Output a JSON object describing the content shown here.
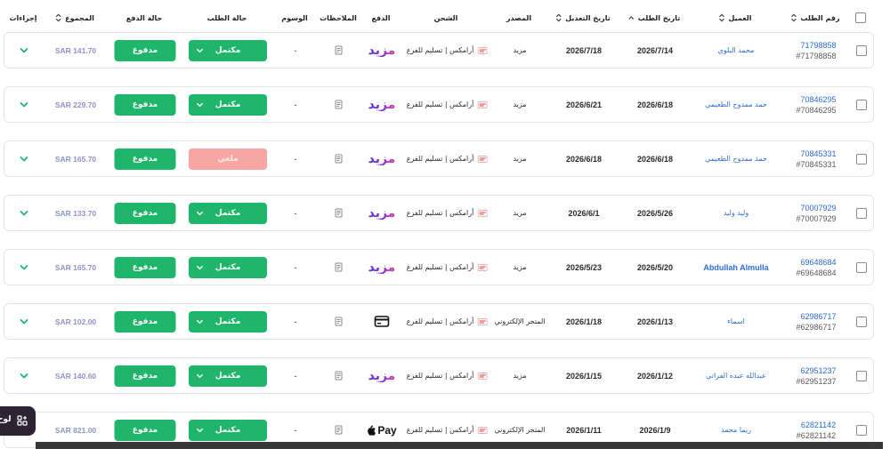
{
  "header": {
    "columns": {
      "order_number": "رقم الطلب",
      "customer": "العميل",
      "order_date": "تاريخ الطلب",
      "modified_date": "تاريخ التعديل",
      "source": "المصدر",
      "shipping": "الشحن",
      "payment": "الدفع",
      "notes": "الملاحظات",
      "tags": "الوسوم",
      "order_status": "حالة الطلب",
      "payment_status": "حالة الدفع",
      "total": "المجموع",
      "actions": "إجراءات"
    },
    "sort_icons": {
      "order_number": "sort-icon",
      "customer": "sort-icon",
      "order_date": "sort-up-icon",
      "modified_date": "sort-icon",
      "total": "sort-icon"
    }
  },
  "orders": [
    {
      "number": "71798858",
      "number_hash": "#71798858",
      "customer": "محمد البلوي",
      "order_date": "2026/7/14",
      "modified_date": "2026/7/18",
      "source": "مزيد",
      "shipping_icon": "aramex-icon",
      "shipping": "أرامكس | تسليم للفرع",
      "payment_method": "mazeed",
      "payment_label": "مزيد",
      "notes_icon": "note-icon",
      "tags": "-",
      "status": "مكتمل",
      "status_type": "completed",
      "payment_status": "مدفوع",
      "total": "SAR 141.70"
    },
    {
      "number": "70846295",
      "number_hash": "#70846295",
      "customer": "حمد ممدوح الطعيمي",
      "order_date": "2026/6/18",
      "modified_date": "2026/6/21",
      "source": "مزيد",
      "shipping_icon": "aramex-icon",
      "shipping": "أرامكس | تسليم للفرع",
      "payment_method": "mazeed",
      "payment_label": "مزيد",
      "notes_icon": "note-icon",
      "tags": "-",
      "status": "مكتمل",
      "status_type": "completed",
      "payment_status": "مدفوع",
      "total": "SAR 229.70"
    },
    {
      "number": "70845331",
      "number_hash": "#70845331",
      "customer": "حمد ممدوح الطعيمي",
      "order_date": "2026/6/18",
      "modified_date": "2026/6/18",
      "source": "مزيد",
      "shipping_icon": "aramex-icon",
      "shipping": "أرامكس | تسليم للفرع",
      "payment_method": "mazeed",
      "payment_label": "مزيد",
      "notes_icon": "note-icon",
      "tags": "-",
      "status": "ملغي",
      "status_type": "cancelled",
      "payment_status": "مدفوع",
      "total": "SAR 165.70"
    },
    {
      "number": "70007929",
      "number_hash": "#70007929",
      "customer": "وليد وليد",
      "order_date": "2026/5/26",
      "modified_date": "2026/6/1",
      "source": "مزيد",
      "shipping_icon": "aramex-icon",
      "shipping": "أرامكس | تسليم للفرع",
      "payment_method": "mazeed",
      "payment_label": "مزيد",
      "notes_icon": "note-icon",
      "tags": "-",
      "status": "مكتمل",
      "status_type": "completed",
      "payment_status": "مدفوع",
      "total": "SAR 133.70"
    },
    {
      "number": "69648684",
      "number_hash": "#69648684",
      "customer": "Abdullah Almulla",
      "order_date": "2026/5/20",
      "modified_date": "2026/5/23",
      "source": "مزيد",
      "shipping_icon": "aramex-icon",
      "shipping": "أرامكس | تسليم للفرع",
      "payment_method": "mazeed",
      "payment_label": "مزيد",
      "notes_icon": "note-icon",
      "tags": "-",
      "status": "مكتمل",
      "status_type": "completed",
      "payment_status": "مدفوع",
      "total": "SAR 165.70"
    },
    {
      "number": "62986717",
      "number_hash": "#62986717",
      "customer": "اسماء",
      "order_date": "2026/1/13",
      "modified_date": "2026/1/18",
      "source": "المتجر الإلكتروني",
      "shipping_icon": "aramex-icon",
      "shipping": "أرامكس | تسليم للفرع",
      "payment_method": "card",
      "payment_icon": "credit-card-icon",
      "notes_icon": "note-icon",
      "tags": "-",
      "status": "مكتمل",
      "status_type": "completed",
      "payment_status": "مدفوع",
      "total": "SAR 102.00"
    },
    {
      "number": "62951237",
      "number_hash": "#62951237",
      "customer": "عبدالله عبده الفراتي",
      "order_date": "2026/1/12",
      "modified_date": "2026/1/15",
      "source": "مزيد",
      "shipping_icon": "aramex-icon",
      "shipping": "أرامكس | تسليم للفرع",
      "payment_method": "mazeed",
      "payment_label": "مزيد",
      "notes_icon": "note-icon",
      "tags": "-",
      "status": "مكتمل",
      "status_type": "completed",
      "payment_status": "مدفوع",
      "total": "SAR 140.60"
    },
    {
      "number": "62821142",
      "number_hash": "#62821142",
      "customer": "ريما محمد",
      "order_date": "2026/1/9",
      "modified_date": "2026/1/11",
      "source": "المتجر الإلكتروني",
      "shipping_icon": "aramex-icon",
      "shipping": "أرامكس | تسليم للفرع",
      "payment_method": "apple_pay",
      "payment_label": "Pay",
      "notes_icon": "note-icon",
      "tags": "-",
      "status": "مكتمل",
      "status_type": "completed",
      "payment_status": "مدفوع",
      "total": "SAR 821.00"
    }
  ],
  "floating_button": {
    "label": "لوح",
    "icon": "grid-icon"
  },
  "colors": {
    "accent_green": "#1fb56a",
    "cancelled_pink": "#f7a6a4",
    "link_blue": "#2b6cd3",
    "total_text": "#8f93c8",
    "floating_bg": "#2c2433"
  }
}
